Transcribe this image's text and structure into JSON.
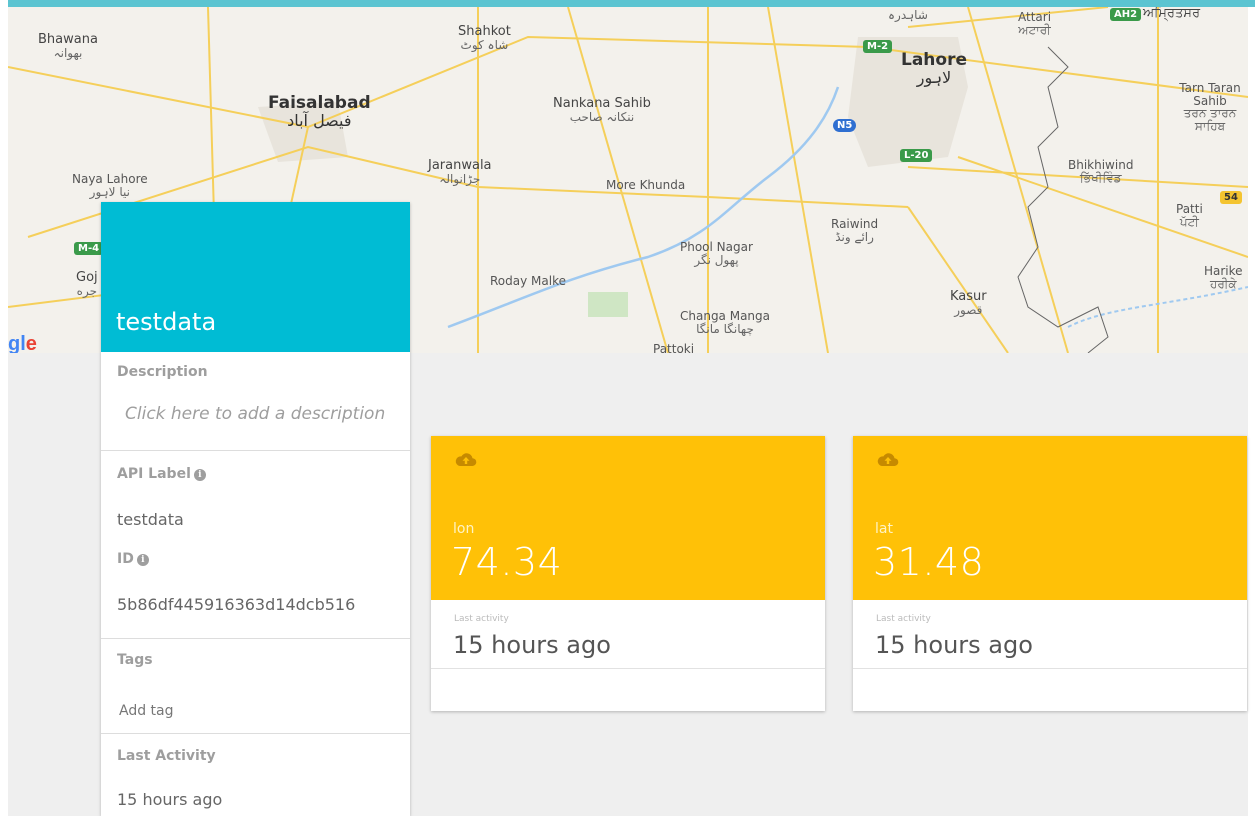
{
  "map": {
    "places": [
      {
        "name": "Bhawana",
        "native": "بھوانہ"
      },
      {
        "name": "Shahkot",
        "native": "شاہ کوٹ"
      },
      {
        "name": "Lahore",
        "native": "لاہور"
      },
      {
        "name": "Attari",
        "native": "ਅਟਾਰੀ"
      },
      {
        "name": "ਅਮ੍ਰਿਤਸਰ",
        "native": ""
      },
      {
        "name": "Faisalabad",
        "native": "فیصل آباد"
      },
      {
        "name": "Nankana Sahib",
        "native": "ننکانہ صاحب"
      },
      {
        "name": "Tarn Taran Sahib",
        "native": "ਤਰਨ ਤਾਰਨ ਸਾਹਿਬ"
      },
      {
        "name": "Jaranwala",
        "native": "جڑانوالہ"
      },
      {
        "name": "Naya Lahore",
        "native": "نیا لاہور"
      },
      {
        "name": "More Khunda",
        "native": ""
      },
      {
        "name": "Bhikhiwind",
        "native": "ਭਿੱਖੀਵਿੰਡ"
      },
      {
        "name": "Patti",
        "native": "ਪੱਟੀ"
      },
      {
        "name": "Raiwind",
        "native": "رائے ونڈ"
      },
      {
        "name": "Phool Nagar",
        "native": "پھول نگر"
      },
      {
        "name": "Harike",
        "native": "ਹਰੀਕੇ"
      },
      {
        "name": "Roday Malke",
        "native": ""
      },
      {
        "name": "Kasur",
        "native": "قصور"
      },
      {
        "name": "Changa Manga",
        "native": "چھانگا مانگا"
      },
      {
        "name": "Goj",
        "native": "جره"
      },
      {
        "name": "Pattoki",
        "native": ""
      },
      {
        "name": "Shahdara",
        "native": "شاہدرہ"
      }
    ],
    "shields": [
      "M-2",
      "N5",
      "L-20",
      "54",
      "AH2",
      "M-4"
    ],
    "logo": "gle",
    "colors": {
      "road": "#f5cf5a",
      "water": "#9fc9f0",
      "border": "#666666",
      "highway": "#3a9a4a"
    }
  },
  "device": {
    "name": "testdata",
    "header_color": "#00bcd4",
    "description_label": "Description",
    "description_placeholder": "Click here to add a description",
    "api_label_title": "API Label",
    "api_label_value": "testdata",
    "id_title": "ID",
    "id_value": "5b86df445916363d14dcb516",
    "tags_title": "Tags",
    "add_tag": "Add tag",
    "last_activity_title": "Last Activity",
    "last_activity_value": "15 hours ago"
  },
  "variables": [
    {
      "name": "lon",
      "value": "74.34",
      "last_activity_label": "Last activity",
      "last_activity": "15 hours ago",
      "icon": "cloud-upload-icon",
      "color": "#ffc107"
    },
    {
      "name": "lat",
      "value": "31.48",
      "last_activity_label": "Last activity",
      "last_activity": "15 hours ago",
      "icon": "cloud-upload-icon",
      "color": "#ffc107"
    }
  ]
}
